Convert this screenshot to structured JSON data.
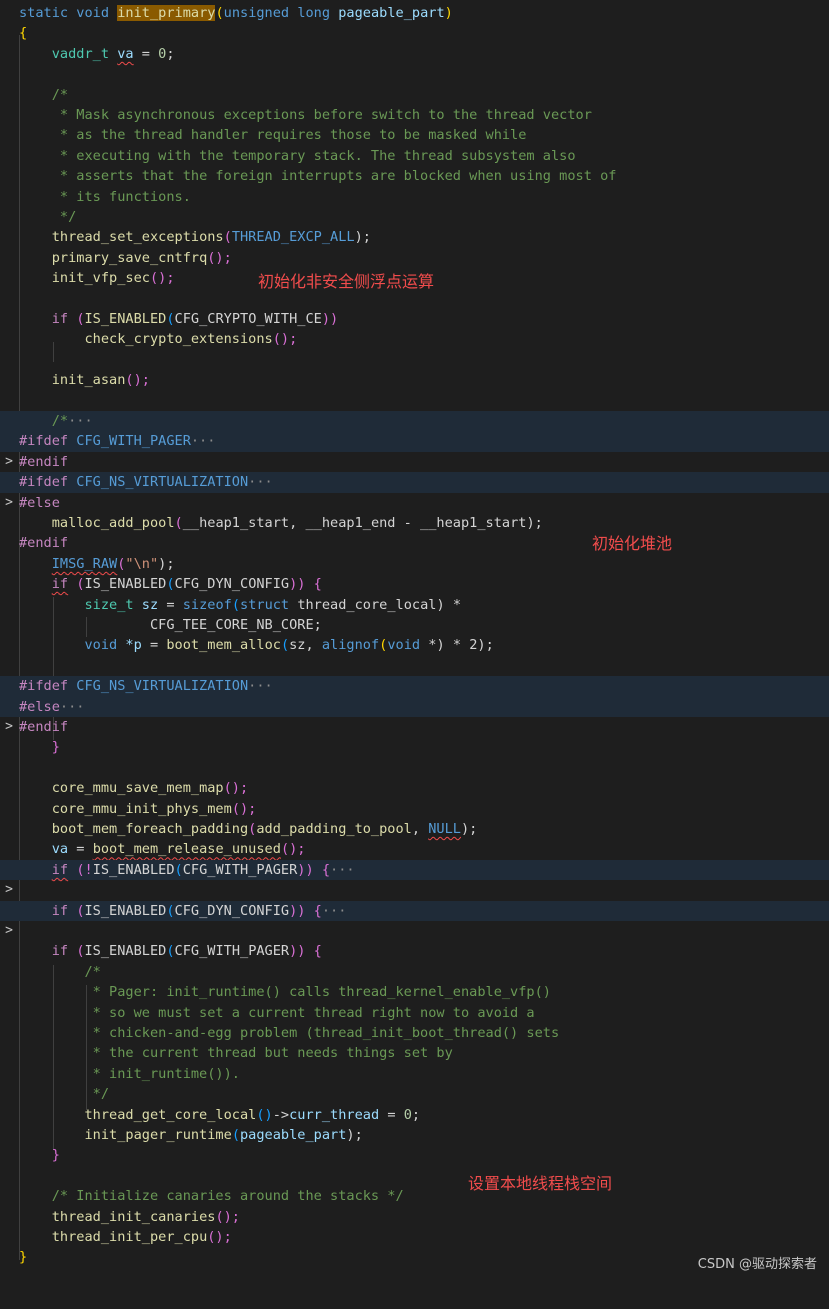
{
  "editor": {
    "lines": {
      "l1": {
        "a": "static",
        "b": "void",
        "c": "init_primary",
        "d": "(",
        "e": "unsigned",
        "f": "long",
        "g": "pageable_part",
        "h": ")"
      },
      "l2": {
        "a": "{"
      },
      "l3": {
        "a": "vaddr_t",
        "b": "va",
        "c": " = ",
        "d": "0",
        ";": ";"
      },
      "l5": "/*",
      "l6": " * Mask asynchronous exceptions before switch to the thread vector",
      "l7": " * as the thread handler requires those to be masked while",
      "l8": " * executing with the temporary stack. The thread subsystem also",
      "l9": " * asserts that the foreign interrupts are blocked when using most of",
      "l10": " * its functions.",
      "l11": " */",
      "l12": {
        "a": "thread_set_exceptions",
        "b": "(",
        "c": "THREAD_EXCP_ALL",
        "d": ");"
      },
      "l13": {
        "a": "primary_save_cntfrq",
        "b": "();"
      },
      "l14": {
        "a": "init_vfp_sec",
        "b": "();"
      },
      "l16": {
        "a": "if",
        "b": "(",
        "c": "IS_ENABLED",
        "d": "(",
        "e": "CFG_CRYPTO_WITH_CE",
        "f": "))"
      },
      "l17": {
        "a": "check_crypto_extensions",
        "b": "();"
      },
      "l19": {
        "a": "init_asan",
        "b": "();"
      },
      "l21": {
        "a": "/*",
        "b": "···"
      },
      "l22": {
        "a": "#ifdef",
        "b": "CFG_WITH_PAGER",
        "c": "···"
      },
      "l23": "#endif",
      "l24": {
        "a": "#ifdef",
        "b": "CFG_NS_VIRTUALIZATION",
        "c": "···"
      },
      "l25": "#else",
      "l26": {
        "a": "malloc_add_pool",
        "b": "(",
        "c": "__heap1_start, __heap1_end - __heap1_start",
        "d": ");"
      },
      "l27": "#endif",
      "l28": {
        "a": "IMSG_RAW",
        "b": "(",
        "c": "\"\\n\"",
        "d": ");"
      },
      "l29": {
        "a": "if",
        "b": "(",
        "c": "IS_ENABLED",
        "d": "(",
        "e": "CFG_DYN_CONFIG",
        "f": "))",
        "g": "{"
      },
      "l30": {
        "a": "size_t",
        "b": "sz",
        "c": " = ",
        "d": "sizeof",
        "e": "(",
        "f": "struct",
        "g": "thread_core_local",
        "h": ") *"
      },
      "l31": "CFG_TEE_CORE_NB_CORE;",
      "l32": {
        "a": "void",
        "b": "*p",
        "c": " = ",
        "d": "boot_mem_alloc",
        "e": "(",
        "f": "sz, ",
        "g": "alignof",
        "h": "(",
        "i": "void",
        "j": " *) * 2);"
      },
      "l34": {
        "a": "#ifdef",
        "b": "CFG_NS_VIRTUALIZATION",
        "c": "···"
      },
      "l35": {
        "a": "#else",
        "b": "···"
      },
      "l36": "#endif",
      "l37": "}",
      "l39": {
        "a": "core_mmu_save_mem_map",
        "b": "();"
      },
      "l40": {
        "a": "core_mmu_init_phys_mem",
        "b": "();"
      },
      "l41": {
        "a": "boot_mem_foreach_padding",
        "b": "(",
        "c": "add_padding_to_pool",
        "d": ", ",
        "e": "NULL",
        "f": ");"
      },
      "l42": {
        "a": "va",
        "b": " = ",
        "c": "boot_mem_release_unused",
        "d": "();"
      },
      "l43": {
        "a": "if",
        "b": "(!",
        "c": "IS_ENABLED",
        "d": "(",
        "e": "CFG_WITH_PAGER",
        "f": "))",
        "g": "{",
        "h": "···"
      },
      "l45": {
        "a": "if",
        "b": "(",
        "c": "IS_ENABLED",
        "d": "(",
        "e": "CFG_DYN_CONFIG",
        "f": "))",
        "g": "{",
        "h": "···"
      },
      "l47": {
        "a": "if",
        "b": "(",
        "c": "IS_ENABLED",
        "d": "(",
        "e": "CFG_WITH_PAGER",
        "f": "))",
        "g": "{"
      },
      "l48": "/*",
      "l49": " * Pager: init_runtime() calls thread_kernel_enable_vfp()",
      "l50": " * so we must set a current thread right now to avoid a",
      "l51": " * chicken-and-egg problem (thread_init_boot_thread() sets",
      "l52": " * the current thread but needs things set by",
      "l53": " * init_runtime()).",
      "l54": " */",
      "l55": {
        "a": "thread_get_core_local",
        "b": "()",
        "c": "->",
        "d": "curr_thread",
        "e": " = ",
        "f": "0",
        ";": ";"
      },
      "l56": {
        "a": "init_pager_runtime",
        "b": "(",
        "c": "pageable_part",
        "d": ");"
      },
      "l57": "}",
      "l59": "/* Initialize canaries around the stacks */",
      "l60": {
        "a": "thread_init_canaries",
        "b": "();"
      },
      "l61": {
        "a": "thread_init_per_cpu",
        "b": "();"
      },
      "l62": "}"
    },
    "fold_marker": ">"
  },
  "notes": {
    "vfp": "初始化非安全侧浮点运算",
    "heap": "初始化堆池",
    "stack": "设置本地线程栈空间"
  },
  "watermark": "CSDN @驱动探索者"
}
